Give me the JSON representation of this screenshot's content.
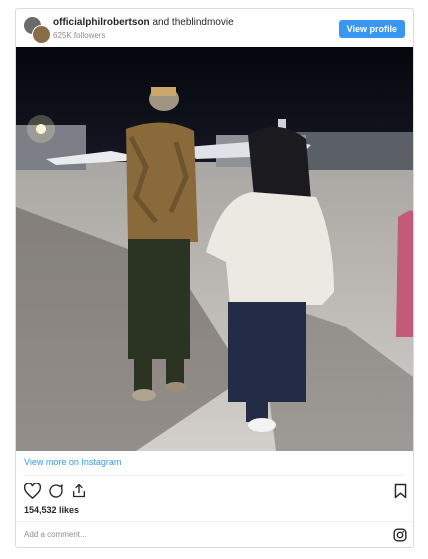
{
  "header": {
    "account_primary": "officialphilrobertson",
    "connector": "and",
    "account_secondary": "theblindmovie",
    "followers": "625K followers",
    "view_profile": "View profile"
  },
  "photo": {
    "description_icon": "photo-image"
  },
  "footer": {
    "view_more": "View more on Instagram",
    "likes": "154,532 likes",
    "comment_placeholder": "Add a comment..."
  },
  "icons": {
    "like": "heart-icon",
    "comment": "comment-icon",
    "share": "share-icon",
    "save": "bookmark-icon",
    "brand": "instagram-icon"
  },
  "colors": {
    "accent": "#3897f0",
    "text": "#262626",
    "muted": "#8e8e8e"
  }
}
